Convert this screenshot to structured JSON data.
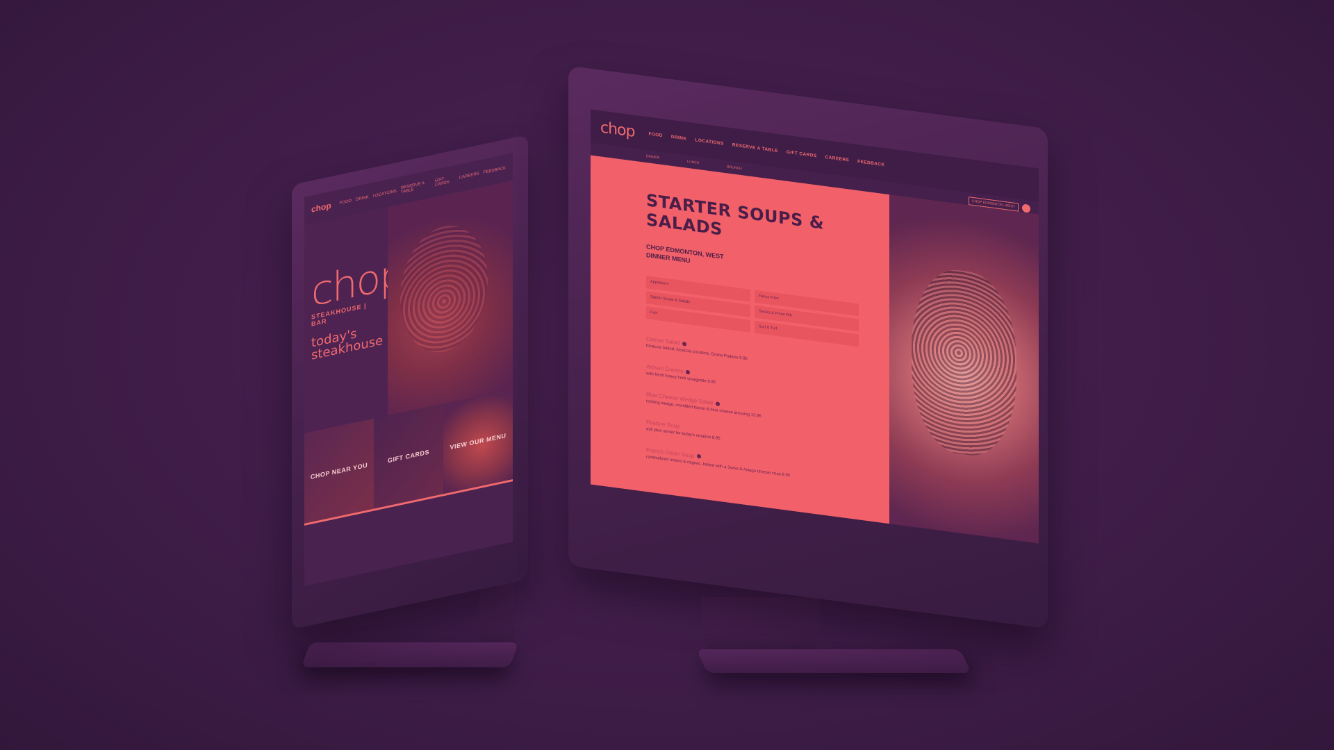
{
  "left_site": {
    "nav_logo": "chop",
    "nav_items": [
      "FOOD",
      "DRINK",
      "LOCATIONS",
      "RESERVE A TABLE",
      "GIFT CARDS",
      "CAREERS",
      "FEEDBACK"
    ],
    "logo": "chop",
    "logo_sub": "STEAKHOUSE | BAR",
    "tagline": "today's steakhouse",
    "tiles": [
      "CHOP NEAR YOU",
      "GIFT CARDS",
      "VIEW OUR MENU"
    ]
  },
  "right_site": {
    "logo": "chop",
    "nav_items": [
      "FOOD",
      "DRINK",
      "LOCATIONS",
      "RESERVE A TABLE",
      "GIFT CARDS",
      "CAREERS",
      "FEEDBACK"
    ],
    "subnav": [
      "DINNER",
      "LUNCH",
      "BRUNCH"
    ],
    "tools": {
      "location": "CHOP EDMONTON, WEST"
    },
    "title": "STARTER SOUPS & SALADS",
    "subtitle_line1": "CHOP EDMONTON, WEST",
    "subtitle_line2": "DINNER MENU",
    "categories": [
      "Appetizers",
      "Fancy Fries",
      "Starter Soups & Salads",
      "Steaks & Prime Rib",
      "Fish",
      "Surf & Turf"
    ],
    "menu_items": [
      {
        "name": "Caesar Salad",
        "desc": "focaccia baked, focaccia croutons, Grana Padano 9.95"
      },
      {
        "name": "Artisan Greens",
        "desc": "with fresh honey herb vinaigrette 9.95"
      },
      {
        "name": "Blue Cheese Wedge Salad",
        "desc": "iceberg wedge, crumbled bacon & blue cheese dressing 13.95"
      },
      {
        "name": "Feature Soup",
        "desc": "ask your server for today's creation 8.95"
      },
      {
        "name": "French Onion Soup",
        "desc": "caramelized onions & cognac, baked with a Swiss & Asiago cheese crust 9.95"
      }
    ]
  },
  "colors": {
    "background": "#3f1d48",
    "accent": "#f06a6e",
    "dark": "#4a1e48"
  }
}
